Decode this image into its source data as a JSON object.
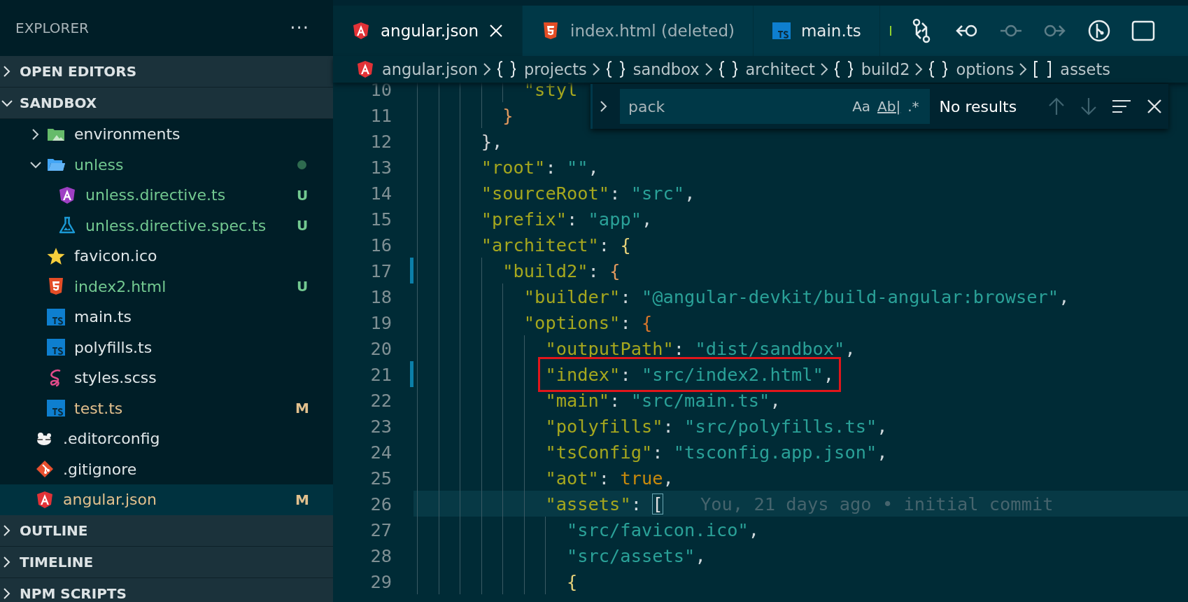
{
  "sidebar": {
    "title": "EXPLORER",
    "more": "···",
    "sections": [
      {
        "label": "OPEN EDITORS",
        "expanded": false
      },
      {
        "label": "SANDBOX",
        "expanded": true,
        "tree": [
          {
            "children": [
              {
                "label": "environments",
                "kind": "folder-env",
                "expanded": false,
                "selected": false
              },
              {
                "label": "unless",
                "kind": "folder",
                "expanded": true,
                "selected": false,
                "color": "#73c991",
                "dot": true,
                "children": [
                  {
                    "label": "unless.directive.ts",
                    "kind": "angular-directive",
                    "selected": false,
                    "color": "#73c991",
                    "status": "U"
                  },
                  {
                    "label": "unless.directive.spec.ts",
                    "kind": "test",
                    "selected": false,
                    "color": "#73c991",
                    "status": "U"
                  }
                ]
              },
              {
                "label": "favicon.ico",
                "kind": "favicon",
                "selected": false
              },
              {
                "label": "index2.html",
                "kind": "html",
                "selected": false,
                "color": "#73c991",
                "status": "U"
              },
              {
                "label": "main.ts",
                "kind": "ts",
                "selected": false
              },
              {
                "label": "polyfills.ts",
                "kind": "ts",
                "selected": false
              },
              {
                "label": "styles.scss",
                "kind": "scss",
                "selected": false
              },
              {
                "label": "test.ts",
                "kind": "ts",
                "selected": false,
                "color": "#e2c08d",
                "status": "M"
              }
            ]
          },
          {
            "label": ".editorconfig",
            "kind": "editorconfig",
            "selected": false
          },
          {
            "label": ".gitignore",
            "kind": "git",
            "selected": false
          },
          {
            "label": "angular.json",
            "kind": "angular",
            "selected": true,
            "color": "#e2c08d",
            "status": "M"
          }
        ]
      },
      {
        "label": "OUTLINE",
        "expanded": false
      },
      {
        "label": "TIMELINE",
        "expanded": false
      },
      {
        "label": "NPM SCRIPTS",
        "expanded": false
      }
    ]
  },
  "tabs": [
    {
      "label": "angular.json",
      "kind": "angular",
      "selected": true,
      "deleted": false
    },
    {
      "label": "index.html (deleted)",
      "kind": "html",
      "selected": false,
      "deleted": true
    },
    {
      "label": "main.ts",
      "kind": "ts",
      "selected": false,
      "deleted": false
    }
  ],
  "toolbar": [
    {
      "kind": "marker",
      "disabled": false
    },
    {
      "kind": "compare",
      "disabled": false
    },
    {
      "kind": "back",
      "disabled": false
    },
    {
      "kind": "commit",
      "disabled": true
    },
    {
      "kind": "forward",
      "disabled": true
    },
    {
      "kind": "graph",
      "disabled": false
    },
    {
      "kind": "split",
      "disabled": false
    }
  ],
  "breadcrumbs": [
    {
      "label": "angular.json",
      "kind": "angular"
    },
    {
      "label": "projects",
      "kind": "object"
    },
    {
      "label": "sandbox",
      "kind": "object"
    },
    {
      "label": "architect",
      "kind": "object"
    },
    {
      "label": "build2",
      "kind": "object"
    },
    {
      "label": "options",
      "kind": "object"
    },
    {
      "label": "assets",
      "kind": "array"
    }
  ],
  "find": {
    "expanded": false,
    "value": "pack",
    "options": [
      {
        "label": "Aa",
        "kind": "case",
        "on": false
      },
      {
        "label": "Ab|",
        "kind": "word",
        "on": false
      },
      {
        "label": ".*",
        "kind": "regex",
        "on": false
      }
    ],
    "message": "No results",
    "prev_disabled": true,
    "next_disabled": true
  },
  "editor": {
    "lines": [
      {
        "number": "10",
        "modified": false,
        "current": false,
        "tokens": [
          {
            "text": "          \"styl",
            "kind": "key"
          }
        ]
      },
      {
        "number": "11",
        "modified": false,
        "current": false,
        "tokens": [
          {
            "text": "        }",
            "kind": "bracket2"
          }
        ]
      },
      {
        "number": "12",
        "modified": false,
        "current": false,
        "tokens": [
          {
            "text": "      }",
            "kind": "bracket3"
          },
          {
            "text": ",",
            "kind": "punct"
          }
        ]
      },
      {
        "number": "13",
        "modified": false,
        "current": false,
        "tokens": [
          {
            "text": "      \"root\"",
            "kind": "key"
          },
          {
            "text": ": ",
            "kind": "punct"
          },
          {
            "text": "\"\"",
            "kind": "string"
          },
          {
            "text": ",",
            "kind": "punct"
          }
        ]
      },
      {
        "number": "14",
        "modified": false,
        "current": false,
        "tokens": [
          {
            "text": "      \"sourceRoot\"",
            "kind": "key"
          },
          {
            "text": ": ",
            "kind": "punct"
          },
          {
            "text": "\"src\"",
            "kind": "string"
          },
          {
            "text": ",",
            "kind": "punct"
          }
        ]
      },
      {
        "number": "15",
        "modified": false,
        "current": false,
        "tokens": [
          {
            "text": "      \"prefix\"",
            "kind": "key"
          },
          {
            "text": ": ",
            "kind": "punct"
          },
          {
            "text": "\"app\"",
            "kind": "string"
          },
          {
            "text": ",",
            "kind": "punct"
          }
        ]
      },
      {
        "number": "16",
        "modified": false,
        "current": false,
        "tokens": [
          {
            "text": "      \"architect\"",
            "kind": "key"
          },
          {
            "text": ": ",
            "kind": "punct"
          },
          {
            "text": "{",
            "kind": "bracket1"
          }
        ]
      },
      {
        "number": "17",
        "modified": true,
        "current": false,
        "tokens": [
          {
            "text": "        \"build2\"",
            "kind": "key"
          },
          {
            "text": ": ",
            "kind": "punct"
          },
          {
            "text": "{",
            "kind": "bracket2"
          }
        ]
      },
      {
        "number": "18",
        "modified": false,
        "current": false,
        "tokens": [
          {
            "text": "          \"builder\"",
            "kind": "key"
          },
          {
            "text": ": ",
            "kind": "punct"
          },
          {
            "text": "\"@angular-devkit/build-angular:browser\"",
            "kind": "string"
          },
          {
            "text": ",",
            "kind": "punct"
          }
        ]
      },
      {
        "number": "19",
        "modified": false,
        "current": false,
        "tokens": [
          {
            "text": "          \"options\"",
            "kind": "key"
          },
          {
            "text": ": ",
            "kind": "punct"
          },
          {
            "text": "{",
            "kind": "bracket4"
          }
        ]
      },
      {
        "number": "20",
        "modified": false,
        "current": false,
        "tokens": [
          {
            "text": "            \"outputPath\"",
            "kind": "key"
          },
          {
            "text": ": ",
            "kind": "punct"
          },
          {
            "text": "\"dist/sandbox\"",
            "kind": "string"
          },
          {
            "text": ",",
            "kind": "punct"
          }
        ]
      },
      {
        "number": "21",
        "modified": true,
        "current": false,
        "boxed": true,
        "tokens": [
          {
            "text": "            \"index\"",
            "kind": "key"
          },
          {
            "text": ": ",
            "kind": "punct"
          },
          {
            "text": "\"src/index2.html\"",
            "kind": "string"
          },
          {
            "text": ",",
            "kind": "punct"
          }
        ]
      },
      {
        "number": "22",
        "modified": false,
        "current": false,
        "tokens": [
          {
            "text": "            \"main\"",
            "kind": "key"
          },
          {
            "text": ": ",
            "kind": "punct"
          },
          {
            "text": "\"src/main.ts\"",
            "kind": "string"
          },
          {
            "text": ",",
            "kind": "punct"
          }
        ]
      },
      {
        "number": "23",
        "modified": false,
        "current": false,
        "tokens": [
          {
            "text": "            \"polyfills\"",
            "kind": "key"
          },
          {
            "text": ": ",
            "kind": "punct"
          },
          {
            "text": "\"src/polyfills.ts\"",
            "kind": "string"
          },
          {
            "text": ",",
            "kind": "punct"
          }
        ]
      },
      {
        "number": "24",
        "modified": false,
        "current": false,
        "tokens": [
          {
            "text": "            \"tsConfig\"",
            "kind": "key"
          },
          {
            "text": ": ",
            "kind": "punct"
          },
          {
            "text": "\"tsconfig.app.json\"",
            "kind": "string"
          },
          {
            "text": ",",
            "kind": "punct"
          }
        ]
      },
      {
        "number": "25",
        "modified": false,
        "current": false,
        "tokens": [
          {
            "text": "            \"aot\"",
            "kind": "key"
          },
          {
            "text": ": ",
            "kind": "punct"
          },
          {
            "text": "true",
            "kind": "bool"
          },
          {
            "text": ",",
            "kind": "punct"
          }
        ]
      },
      {
        "number": "26",
        "modified": false,
        "current": true,
        "blame": "You, 21 days ago • initial commit",
        "tokens": [
          {
            "text": "            \"assets\"",
            "kind": "key"
          },
          {
            "text": ": ",
            "kind": "punct"
          },
          {
            "text": "[",
            "kind": "bracket-match"
          }
        ]
      },
      {
        "number": "27",
        "modified": false,
        "current": false,
        "tokens": [
          {
            "text": "              \"src/favicon.ico\"",
            "kind": "string"
          },
          {
            "text": ",",
            "kind": "punct"
          }
        ]
      },
      {
        "number": "28",
        "modified": false,
        "current": false,
        "tokens": [
          {
            "text": "              \"src/assets\"",
            "kind": "string"
          },
          {
            "text": ",",
            "kind": "punct"
          }
        ]
      },
      {
        "number": "29",
        "modified": false,
        "current": false,
        "tokens": [
          {
            "text": "              {",
            "kind": "bracket1"
          }
        ]
      }
    ]
  }
}
